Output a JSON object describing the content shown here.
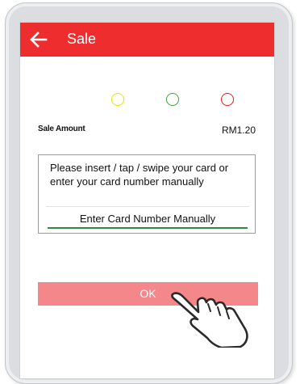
{
  "appbar": {
    "title": "Sale",
    "back_icon": "back-arrow-icon",
    "color": "#ee2e2e"
  },
  "status_lights": [
    {
      "name": "yellow",
      "color": "#e6e600"
    },
    {
      "name": "green",
      "color": "#3fa63f"
    },
    {
      "name": "red",
      "color": "#e02020"
    }
  ],
  "sale": {
    "amount_label": "Sale Amount",
    "amount_value": "RM1.20"
  },
  "card_prompt": {
    "message": "Please insert / tap / swipe your card or enter your card number manually",
    "manual_entry_label": "Enter Card Number Manually"
  },
  "actions": {
    "ok_label": "OK"
  },
  "overlay": {
    "pointer_icon": "tap-hand-icon"
  }
}
